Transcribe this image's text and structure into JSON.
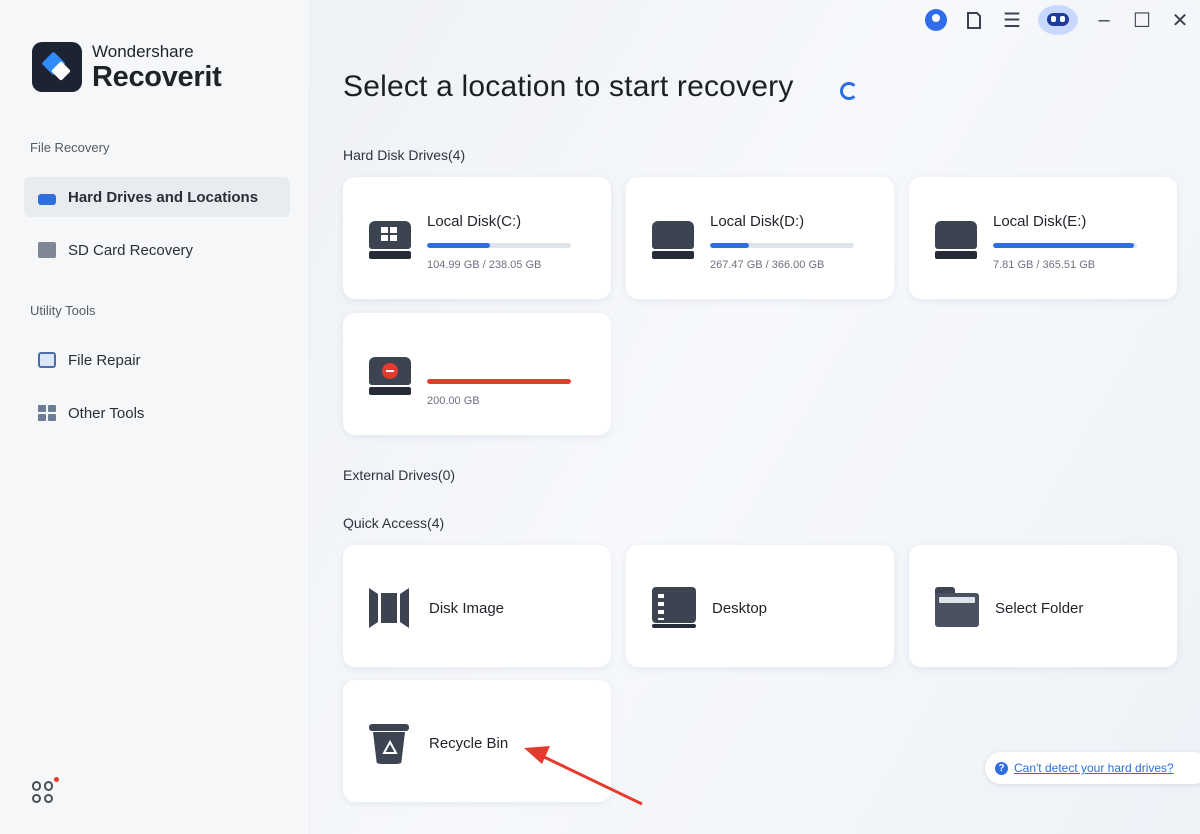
{
  "app": {
    "brand_small": "Wondershare",
    "brand_big": "Recoverit"
  },
  "sidebar": {
    "sections": [
      {
        "label": "File Recovery"
      },
      {
        "label": "Utility Tools"
      }
    ],
    "items": [
      {
        "label": "Hard Drives and Locations",
        "icon": "hard-drive-icon",
        "active": true
      },
      {
        "label": "SD Card Recovery",
        "icon": "sd-card-icon"
      },
      {
        "label": "File Repair",
        "icon": "file-repair-icon"
      },
      {
        "label": "Other Tools",
        "icon": "other-tools-icon"
      }
    ]
  },
  "main": {
    "title": "Select a location to start recovery",
    "hard_disk_label": "Hard Disk Drives(4)",
    "external_label": "External Drives(0)",
    "quick_access_label": "Quick Access(4)",
    "drives": [
      {
        "name": "Local Disk(C:)",
        "size": "104.99 GB / 238.05 GB",
        "used_fraction": 0.44,
        "icon": "windows-disk-icon"
      },
      {
        "name": "Local Disk(D:)",
        "size": "267.47 GB / 366.00 GB",
        "used_fraction": 0.27,
        "icon": "disk-icon"
      },
      {
        "name": "Local Disk(E:)",
        "size": "7.81 GB / 365.51 GB",
        "used_fraction": 0.98,
        "icon": "disk-icon"
      },
      {
        "name": "",
        "size": "200.00 GB",
        "used_fraction": 1.0,
        "icon": "error-disk-icon"
      }
    ],
    "quick_access": [
      {
        "label": "Disk Image",
        "icon": "disk-image-icon"
      },
      {
        "label": "Desktop",
        "icon": "desktop-icon"
      },
      {
        "label": "Select Folder",
        "icon": "folder-icon"
      },
      {
        "label": "Recycle Bin",
        "icon": "recycle-bin-icon"
      }
    ],
    "help_link": "Can't detect your hard drives?"
  },
  "window": {
    "minimize": "–",
    "maximize": "☐",
    "close": "✕",
    "menu": "☰"
  },
  "colors": {
    "accent": "#2e6fe0",
    "danger": "#ea3a2c",
    "annotation_arrow": "#e53b2f"
  }
}
